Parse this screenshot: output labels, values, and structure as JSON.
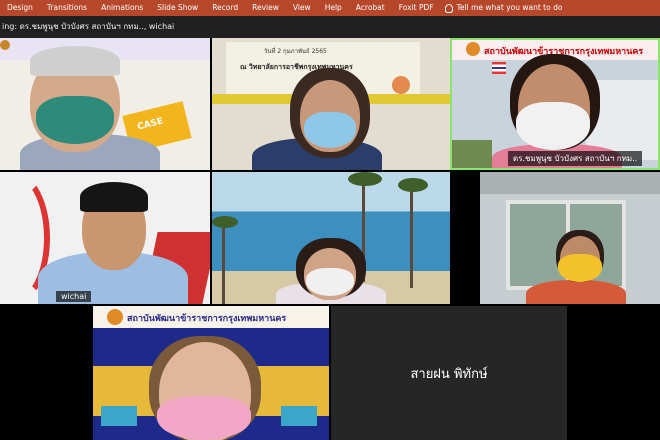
{
  "ribbon": {
    "tabs": [
      "Design",
      "Transitions",
      "Animations",
      "Slide Show",
      "Record",
      "Review",
      "View",
      "Help",
      "Acrobat",
      "Foxit PDF"
    ],
    "tell_me": "Tell me what you want to do"
  },
  "meeting": {
    "speaking_label": "ing: ดร.ชมพูนุช บัวบังศร สถาบันฯ กทม.., wichai"
  },
  "participants": {
    "p3_name": "ดร.ชมพูนุช บัวบังศร สถาบันฯ กทม..",
    "p4_name": "wichai",
    "p8_name": "สายฝน พิทักษ์"
  },
  "backgrounds": {
    "p2_sign_line1": "วันที่  2  กุมภาพันธ์  2565",
    "p2_sign_line2": "ณ วิทยาลัยการอาชีพกรุงเทพมหานคร",
    "p3_banner": "สถาบันพัฒนาข้าราชการกรุงเทพมหานคร",
    "p7_banner": "สถาบันพัฒนาข้าราชการกรุงเทพมหานคร",
    "p1_card": "CASE"
  },
  "colors": {
    "ribbon": "#b7472a",
    "active_border": "#8be36d"
  }
}
